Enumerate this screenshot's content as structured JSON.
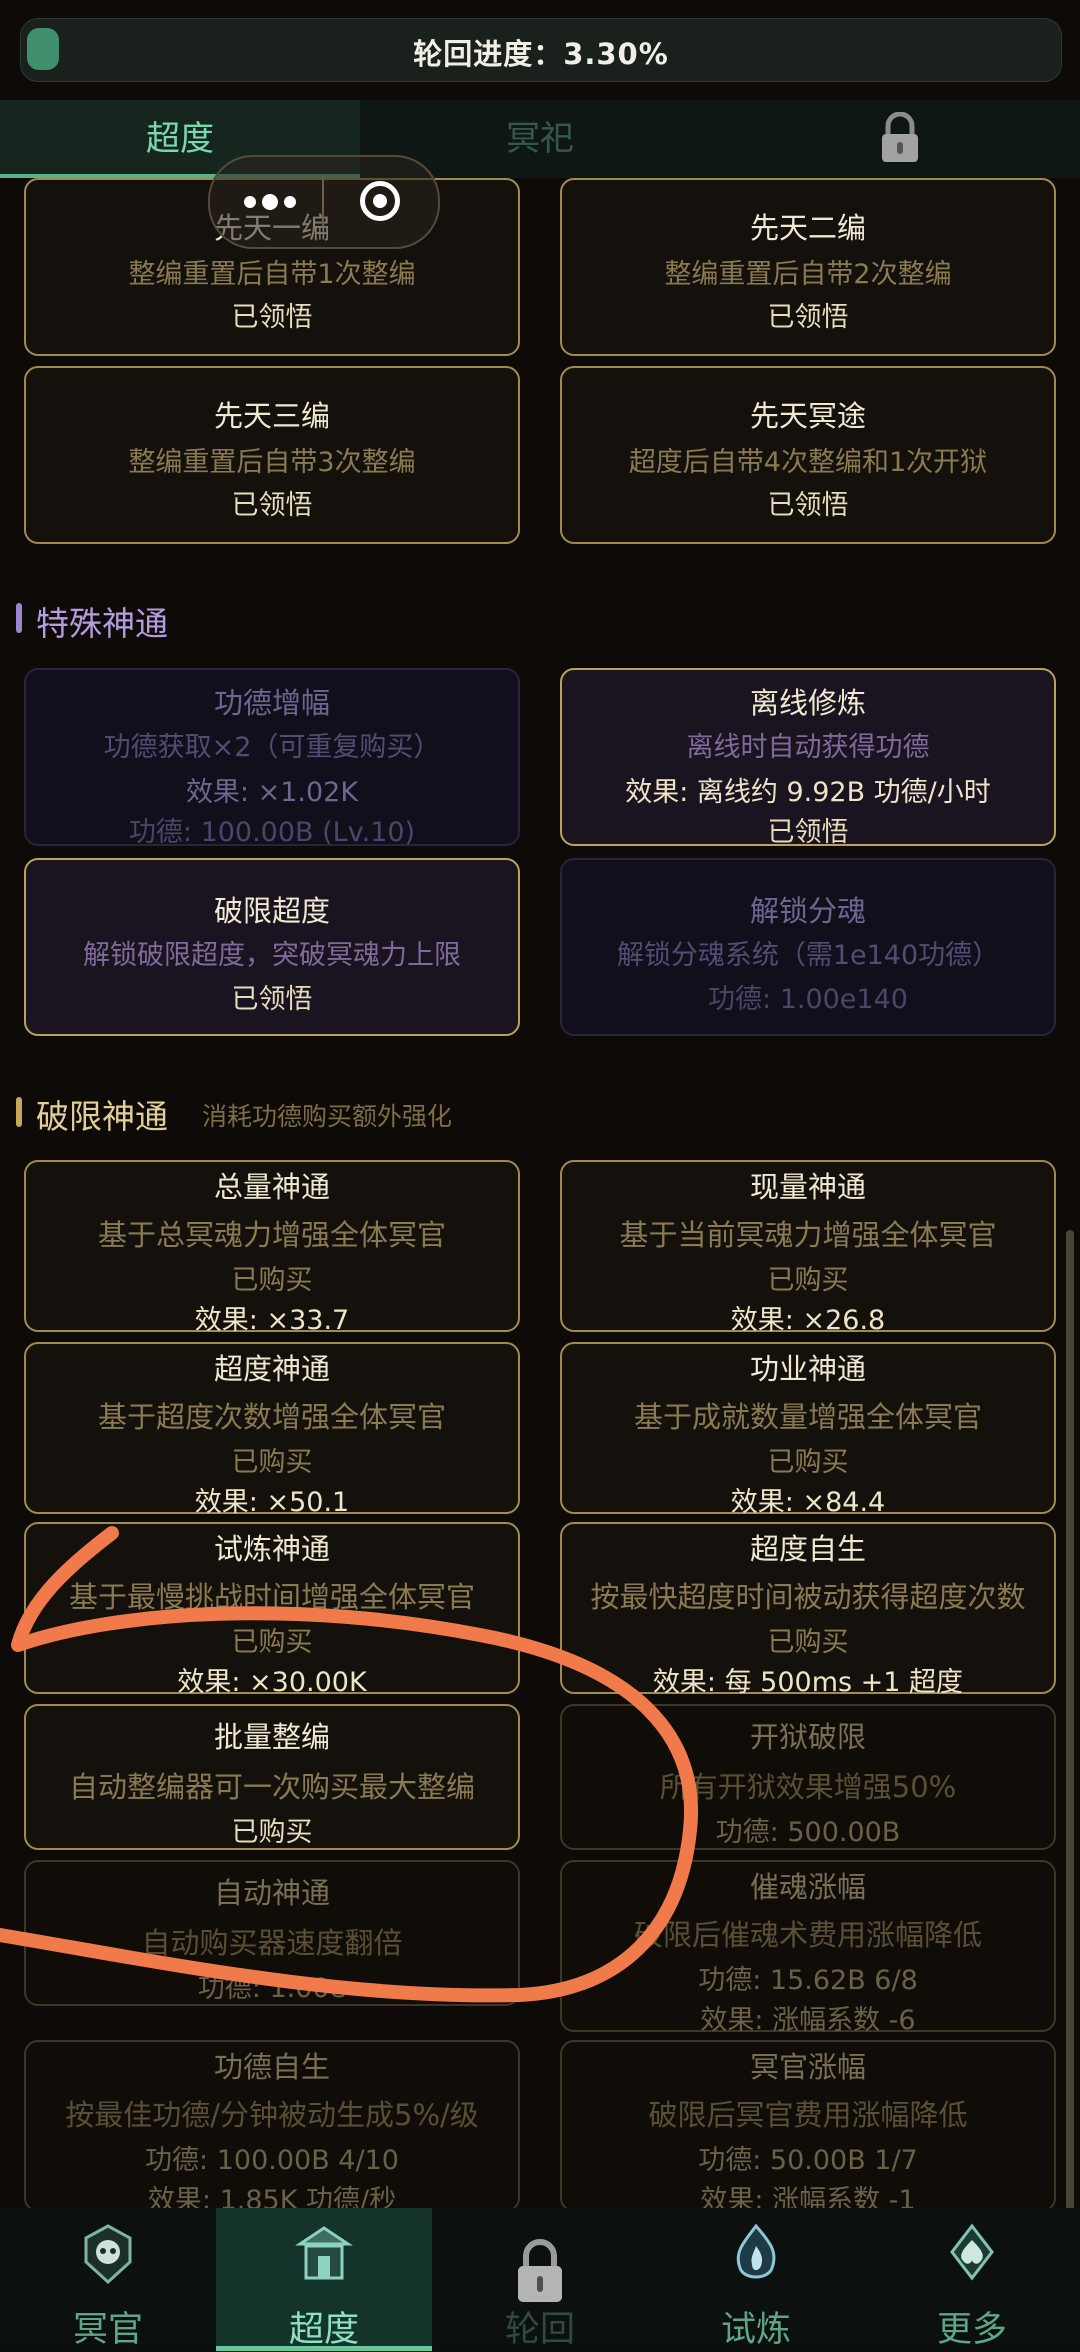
{
  "progress": {
    "text": "轮回进度：3.30%",
    "percent": 3.3
  },
  "tabs": [
    {
      "label": "超度",
      "active": true
    },
    {
      "label": "冥祀",
      "active": false
    },
    {
      "label": "",
      "locked": true
    }
  ],
  "top_cards": [
    {
      "title": "先天一编",
      "desc": "整编重置后自带1次整编",
      "status": "已领悟"
    },
    {
      "title": "先天二编",
      "desc": "整编重置后自带2次整编",
      "status": "已领悟"
    },
    {
      "title": "先天三编",
      "desc": "整编重置后自带3次整编",
      "status": "已领悟"
    },
    {
      "title": "先天冥途",
      "desc": "超度后自带4次整编和1次开狱",
      "status": "已领悟"
    }
  ],
  "special": {
    "title": "特殊神通",
    "cards": [
      {
        "title": "功德增幅",
        "desc": "功德获取×2（可重复购买）",
        "effect": "效果: ×1.02K",
        "cost": "功德: 100.00B (Lv.10)"
      },
      {
        "title": "离线修炼",
        "desc": "离线时自动获得功德",
        "effect": "效果: 离线约 9.92B 功德/小时",
        "status": "已领悟"
      },
      {
        "title": "破限超度",
        "desc": "解锁破限超度，突破冥魂力上限",
        "status": "已领悟"
      },
      {
        "title": "解锁分魂",
        "desc": "解锁分魂系统（需1e140功德）",
        "cost": "功德: 1.00e140"
      }
    ]
  },
  "breakthrough": {
    "title": "破限神通",
    "subtitle": "消耗功德购买额外强化",
    "cards": [
      {
        "title": "总量神通",
        "desc": "基于总冥魂力增强全体冥官",
        "status": "已购买",
        "effect": "效果: ×33.7"
      },
      {
        "title": "现量神通",
        "desc": "基于当前冥魂力增强全体冥官",
        "status": "已购买",
        "effect": "效果: ×26.8"
      },
      {
        "title": "超度神通",
        "desc": "基于超度次数增强全体冥官",
        "status": "已购买",
        "effect": "效果: ×50.1"
      },
      {
        "title": "功业神通",
        "desc": "基于成就数量增强全体冥官",
        "status": "已购买",
        "effect": "效果: ×84.4"
      },
      {
        "title": "试炼神通",
        "desc": "基于最慢挑战时间增强全体冥官",
        "status": "已购买",
        "effect": "效果: ×30.00K"
      },
      {
        "title": "超度自生",
        "desc": "按最快超度时间被动获得超度次数",
        "status": "已购买",
        "effect": "效果: 每 500ms +1 超度"
      },
      {
        "title": "批量整编",
        "desc": "自动整编器可一次购买最大整编",
        "status": "已购买"
      },
      {
        "title": "开狱破限",
        "desc": "所有开狱效果增强50%",
        "cost": "功德: 500.00B"
      },
      {
        "title": "自动神通",
        "desc": "自动购买器速度翻倍",
        "cost": "功德: 1.00e"
      },
      {
        "title": "催魂涨幅",
        "desc": "破限后催魂术费用涨幅降低",
        "cost": "功德: 15.62B 6/8",
        "effect": "效果: 涨幅系数 -6"
      },
      {
        "title": "功德自生",
        "desc": "按最佳功德/分钟被动生成5%/级",
        "cost": "功德: 100.00B 4/10",
        "effect": "效果: 1.85K 功德/秒"
      },
      {
        "title": "冥官涨幅",
        "desc": "破限后冥官费用涨幅降低",
        "cost": "功德: 50.00B 1/7",
        "effect": "效果: 涨幅系数 -1"
      }
    ]
  },
  "bottom_nav": [
    {
      "label": "冥官",
      "icon": "skull-crest-icon",
      "active": false
    },
    {
      "label": "超度",
      "icon": "temple-crest-icon",
      "active": true
    },
    {
      "label": "轮回",
      "icon": "lock-icon",
      "active": false,
      "locked": true
    },
    {
      "label": "试炼",
      "icon": "flame-crest-icon",
      "active": false
    },
    {
      "label": "更多",
      "icon": "spade-crest-icon",
      "active": false
    }
  ],
  "colors": {
    "accent": "#56b48a",
    "card_border": "#a08d4e",
    "annotation": "#f07a4a",
    "special_title": "#b59ce0"
  }
}
